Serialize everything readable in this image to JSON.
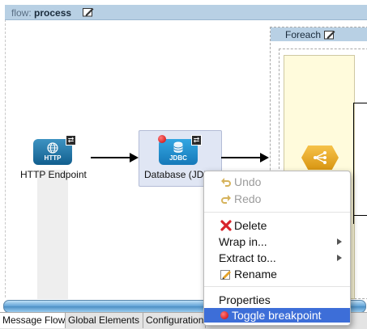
{
  "flow": {
    "label_key": "flow:",
    "label_value": "process"
  },
  "nodes": {
    "http": {
      "icon_text": "HTTP",
      "label": "HTTP Endpoint"
    },
    "database": {
      "icon_text": "JDBC",
      "label": "Database (JDBC)"
    }
  },
  "foreach": {
    "title": "Foreach"
  },
  "context_menu": {
    "undo": "Undo",
    "redo": "Redo",
    "delete": "Delete",
    "wrap_in": "Wrap in...",
    "extract_to": "Extract to...",
    "rename": "Rename",
    "properties": "Properties",
    "toggle_breakpoint": "Toggle breakpoint"
  },
  "tabs": [
    {
      "label": "Message Flow",
      "active": true
    },
    {
      "label": "Global Elements",
      "active": false
    },
    {
      "label": "Configuration XML",
      "active": false
    }
  ],
  "colors": {
    "header_blue": "#b8d0e4",
    "menu_highlight": "#3d6ed8",
    "router_orange": "#e8a92a"
  }
}
